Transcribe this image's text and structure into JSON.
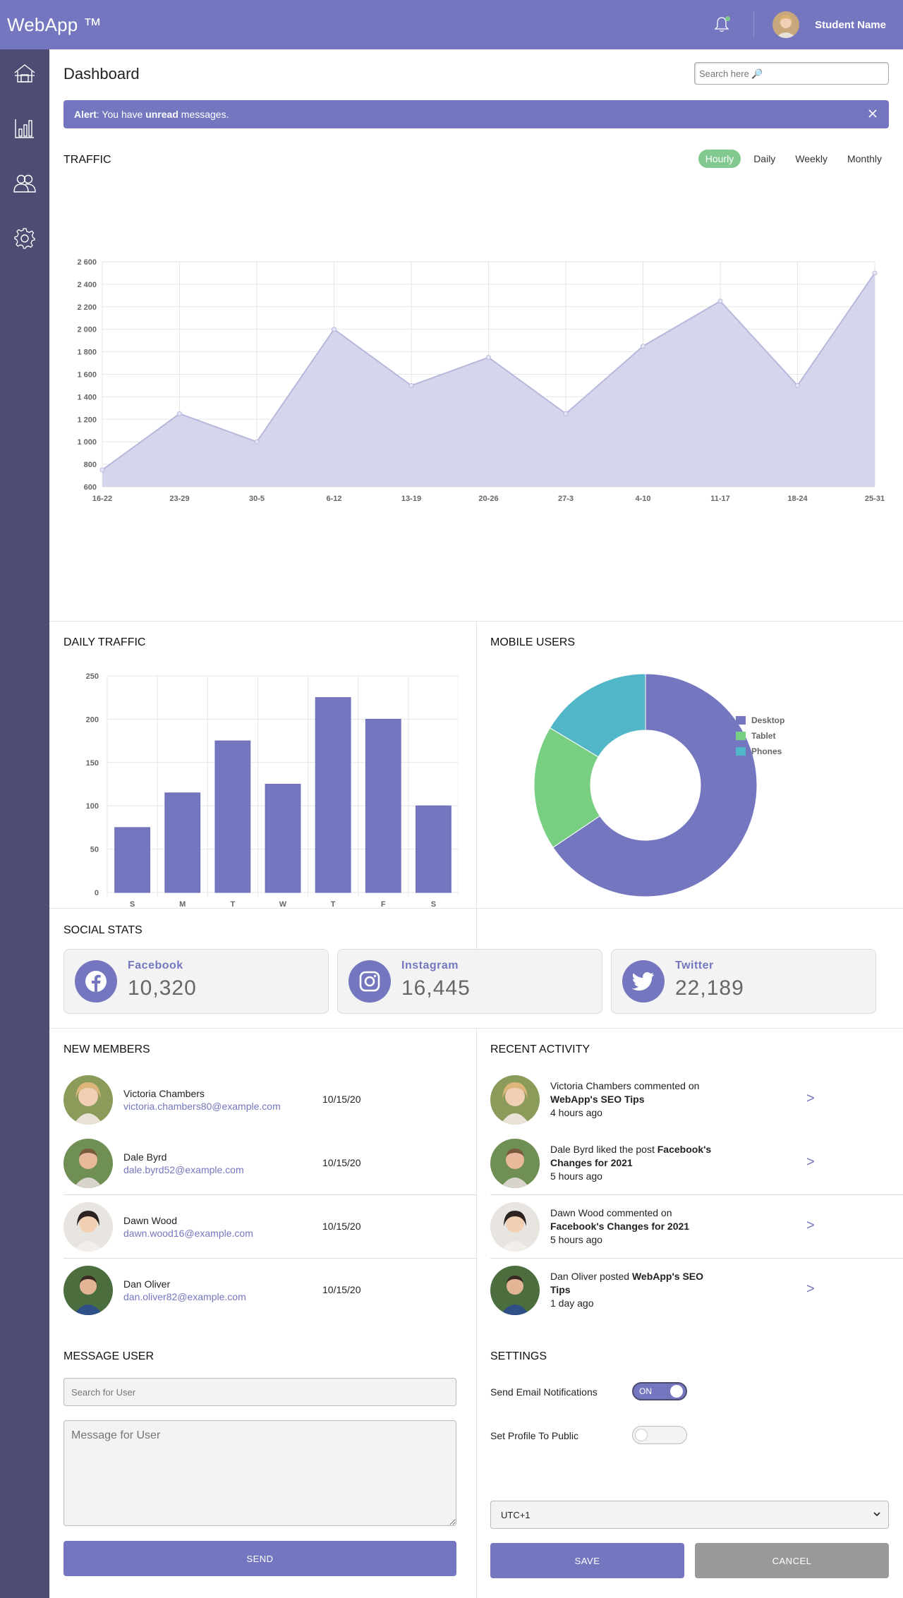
{
  "header": {
    "logo": "WebApp ™",
    "user_name": "Student Name"
  },
  "sidebar": {
    "items": [
      "home-icon",
      "chart-icon",
      "users-icon",
      "settings-icon"
    ]
  },
  "page": {
    "title": "Dashboard",
    "search_placeholder": "Search here 🔎"
  },
  "alert": {
    "label": "Alert",
    "text_before": ": You have ",
    "bold": "unread",
    "text_after": " messages.",
    "close": "✕"
  },
  "traffic": {
    "title": "TRAFFIC",
    "tabs": [
      "Hourly",
      "Daily",
      "Weekly",
      "Monthly"
    ],
    "active_tab": "Hourly"
  },
  "daily_traffic": {
    "title": "DAILY TRAFFIC"
  },
  "mobile_users": {
    "title": "MOBILE USERS",
    "legend": [
      "Desktop",
      "Tablet",
      "Phones"
    ]
  },
  "social": {
    "title": "SOCIAL STATS",
    "cards": [
      {
        "name": "Facebook",
        "count": "10,320",
        "icon": "facebook-icon"
      },
      {
        "name": "Instagram",
        "count": "16,445",
        "icon": "instagram-icon"
      },
      {
        "name": "Twitter",
        "count": "22,189",
        "icon": "twitter-icon"
      }
    ]
  },
  "members": {
    "title": "NEW MEMBERS",
    "list": [
      {
        "name": "Victoria Chambers",
        "email": "victoria.chambers80@example.com",
        "date": "10/15/20"
      },
      {
        "name": "Dale Byrd",
        "email": "dale.byrd52@example.com",
        "date": "10/15/20"
      },
      {
        "name": "Dawn Wood",
        "email": "dawn.wood16@example.com",
        "date": "10/15/20"
      },
      {
        "name": "Dan Oliver",
        "email": "dan.oliver82@example.com",
        "date": "10/15/20"
      }
    ]
  },
  "activity": {
    "title": "RECENT ACTIVITY",
    "arrow": ">",
    "list": [
      {
        "pre": "Victoria Chambers commented on ",
        "bold": "WebApp's SEO Tips",
        "post": "",
        "time": "4 hours ago"
      },
      {
        "pre": "Dale Byrd liked the post ",
        "bold": "Facebook's Changes for 2021",
        "post": "",
        "time": "5 hours ago"
      },
      {
        "pre": "Dawn Wood commented on ",
        "bold": "Facebook's Changes for 2021",
        "post": "",
        "time": "5 hours ago"
      },
      {
        "pre": "Dan Oliver posted ",
        "bold": "WebApp's SEO Tips",
        "post": "",
        "time": "1 day ago"
      }
    ]
  },
  "message": {
    "title": "MESSAGE USER",
    "search_placeholder": "Search for User",
    "message_placeholder": "Message for User",
    "send": "SEND"
  },
  "settings": {
    "title": "SETTINGS",
    "email_label": "Send Email Notifications",
    "email_state": "ON",
    "public_label": "Set Profile To Public",
    "timezone": "UTC+1",
    "save": "SAVE",
    "cancel": "CANCEL"
  },
  "colors": {
    "accent": "#7477bf",
    "sidebar": "#4d4c72",
    "green": "#81c98f",
    "teal": "#51b6c8",
    "area_fill": "#d5d6eb"
  },
  "chart_data": [
    {
      "type": "area",
      "x": [
        "16-22",
        "23-29",
        "30-5",
        "6-12",
        "13-19",
        "20-26",
        "27-3",
        "4-10",
        "11-17",
        "18-24",
        "25-31"
      ],
      "values": [
        750,
        1250,
        1000,
        2000,
        1500,
        1750,
        1250,
        1850,
        2250,
        1500,
        2500
      ],
      "ylim": [
        600,
        2600
      ],
      "yticks": [
        "600",
        "800",
        "1 000",
        "1 200",
        "1 400",
        "1 600",
        "1 800",
        "2 000",
        "2 200",
        "2 400",
        "2 600"
      ],
      "grid": true
    },
    {
      "type": "bar",
      "categories": [
        "S",
        "M",
        "T",
        "W",
        "T",
        "F",
        "S"
      ],
      "values": [
        75,
        115,
        175,
        125,
        225,
        200,
        100
      ],
      "ylim": [
        0,
        250
      ],
      "yticks": [
        "0",
        "50",
        "100",
        "150",
        "200",
        "250"
      ],
      "grid": true
    },
    {
      "type": "pie",
      "categories": [
        "Desktop",
        "Tablet",
        "Phones"
      ],
      "values": [
        2000,
        550,
        500
      ],
      "colors": [
        "#7477bf",
        "#78cf82",
        "#51b6c8"
      ],
      "legend": "right"
    }
  ]
}
